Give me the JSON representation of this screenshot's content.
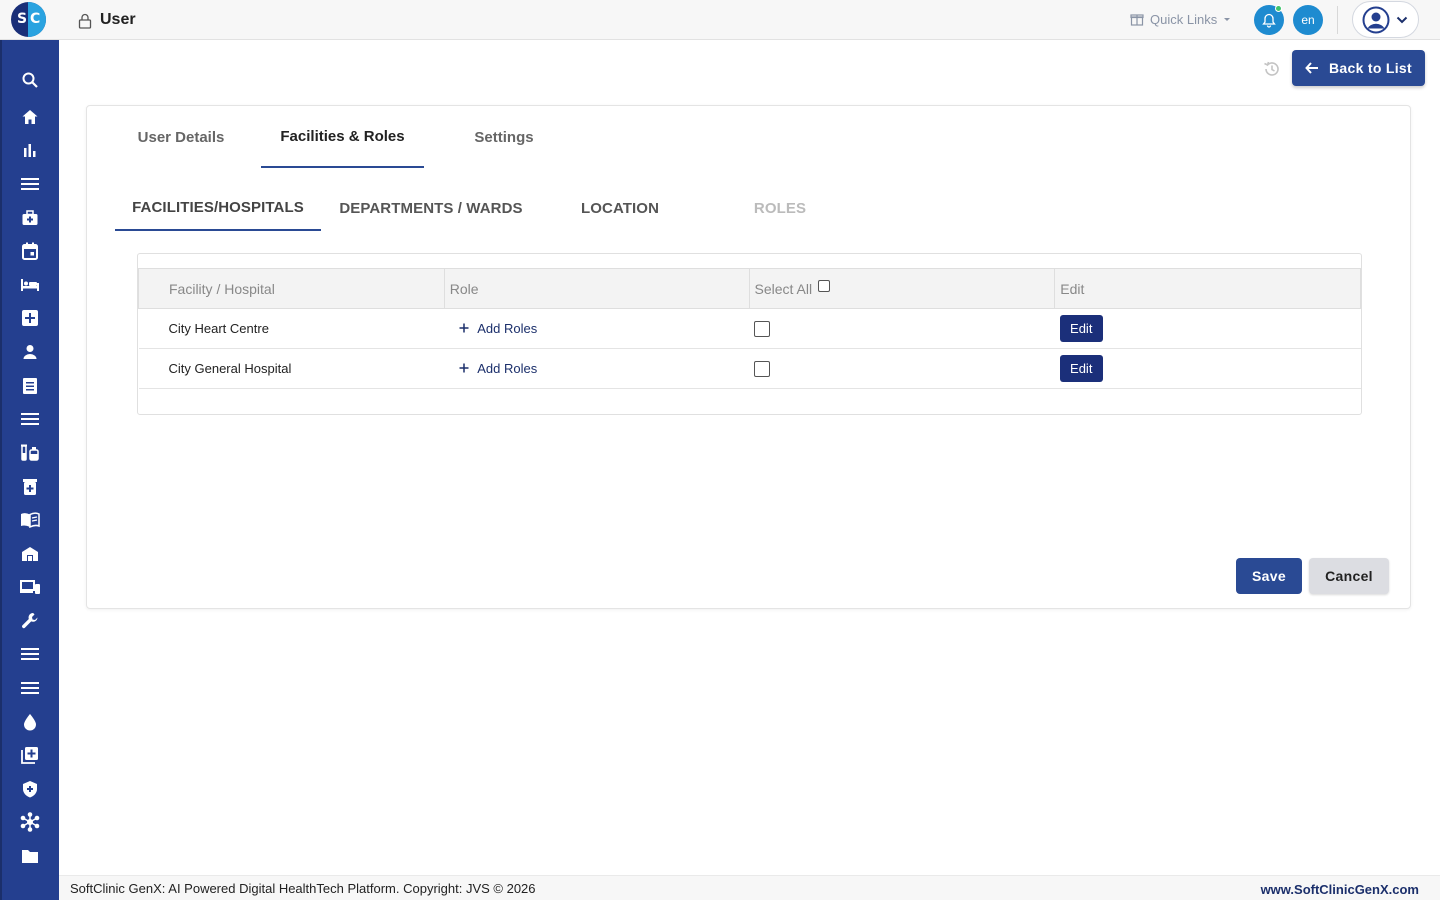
{
  "app": {
    "logo_left": "S",
    "logo_right": "C",
    "page_title": "User"
  },
  "header": {
    "quick_links": "Quick Links",
    "language": "en",
    "back_to_list": "Back to List"
  },
  "tabs": [
    {
      "label": "User Details",
      "active": false
    },
    {
      "label": "Facilities & Roles",
      "active": true
    },
    {
      "label": "Settings",
      "active": false
    }
  ],
  "subtabs": [
    {
      "label": "FACILITIES/HOSPITALS",
      "active": true
    },
    {
      "label": "DEPARTMENTS / WARDS",
      "active": false
    },
    {
      "label": "LOCATION",
      "active": false
    },
    {
      "label": "ROLES",
      "active": false,
      "disabled": true
    }
  ],
  "table": {
    "columns": [
      "Facility / Hospital",
      "Role",
      "Select All",
      "Edit"
    ],
    "rows": [
      {
        "facility": "City Heart Centre",
        "role_action": "Add Roles",
        "selected": false,
        "edit_label": "Edit"
      },
      {
        "facility": "City General Hospital",
        "role_action": "Add Roles",
        "selected": false,
        "edit_label": "Edit"
      }
    ]
  },
  "actions": {
    "save": "Save",
    "cancel": "Cancel"
  },
  "footer": {
    "copyright": "SoftClinic GenX: AI Powered Digital HealthTech Platform. Copyright: JVS © 2026",
    "website": "www.SoftClinicGenX.com"
  },
  "colors": {
    "primary": "#2a4a94",
    "sidebar": "#243f8f",
    "accent_blue": "#1e8bd0",
    "edit_button": "#1b2f7a"
  },
  "sidebar_icons": [
    "search-icon",
    "home-icon",
    "bar-chart-icon",
    "menu-icon",
    "medical-bag-icon",
    "calendar-icon",
    "bed-icon",
    "plus-box-icon",
    "person-icon",
    "receipt-icon",
    "list-icon",
    "lab-icon",
    "medicine-icon",
    "book-icon",
    "warehouse-icon",
    "devices-icon",
    "wrench-icon",
    "menu-icon",
    "list-icon",
    "blood-drop-icon",
    "add-library-icon",
    "shield-icon",
    "hub-icon",
    "folder-icon"
  ]
}
